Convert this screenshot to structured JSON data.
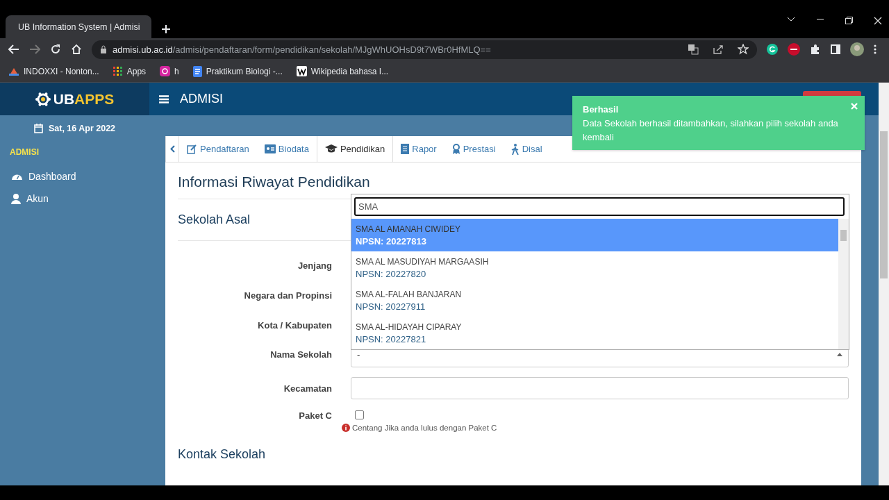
{
  "browser": {
    "tab_title": "UB Information System | Admisi",
    "url_host": "admisi.ub.ac.id",
    "url_path": "/admisi/pendaftaran/form/pendidikan/sekolah/MJgWhUOHsD9t7WBr0HfMLQ==",
    "bookmarks": [
      {
        "label": "INDOXXI - Nonton...",
        "kind": "film"
      },
      {
        "label": "Apps",
        "kind": "apps"
      },
      {
        "label": "h",
        "kind": "camera"
      },
      {
        "label": "Praktikum Biologi -...",
        "kind": "doc"
      },
      {
        "label": "Wikipedia bahasa I...",
        "kind": "wiki"
      }
    ]
  },
  "header": {
    "logo_prefix": "UB",
    "logo_suffix": "APPS",
    "title": "ADMISI"
  },
  "sidebar": {
    "date": "Sat, 16 Apr 2022",
    "section": "ADMISI",
    "items": [
      {
        "label": "Dashboard",
        "kind": "dashboard"
      },
      {
        "label": "Akun",
        "kind": "user"
      }
    ]
  },
  "tabs": [
    {
      "label": "Pendaftaran",
      "kind": "edit",
      "selected": false
    },
    {
      "label": "Biodata",
      "kind": "card",
      "selected": false
    },
    {
      "label": "Pendidikan",
      "kind": "cap",
      "selected": true
    },
    {
      "label": "Rapor",
      "kind": "list",
      "selected": false
    },
    {
      "label": "Prestasi",
      "kind": "award",
      "selected": false
    },
    {
      "label": "Disal",
      "kind": "person",
      "selected": false
    }
  ],
  "form": {
    "title": "Informasi Riwayat Pendidikan",
    "section": "Sekolah Asal",
    "fields": [
      {
        "label": "Jenjang",
        "kind": "hidden"
      },
      {
        "label": "Negara dan Propinsi",
        "kind": "hidden"
      },
      {
        "label": "Kota / Kabupaten",
        "kind": "hidden"
      },
      {
        "label": "Nama Sekolah",
        "kind": "select",
        "value": "-"
      },
      {
        "label": "Kecamatan",
        "kind": "text"
      },
      {
        "label": "Paket C",
        "kind": "checkbox",
        "checked": false,
        "hint": "Centang Jika anda lulus dengan Paket C"
      }
    ],
    "next_section": "Kontak Sekolah"
  },
  "dropdown": {
    "search": "SMA",
    "options": [
      {
        "name": "SMA AL AMANAH CIWIDEY",
        "npsn": "NPSN: 20227813",
        "selected": true
      },
      {
        "name": "SMA AL MASUDIYAH MARGAASIH",
        "npsn": "NPSN: 20227820",
        "selected": false
      },
      {
        "name": "SMA AL-FALAH BANJARAN",
        "npsn": "NPSN: 20227911",
        "selected": false
      },
      {
        "name": "SMA AL-HIDAYAH CIPARAY",
        "npsn": "NPSN: 20227821",
        "selected": false
      }
    ]
  },
  "toast": {
    "title": "Berhasil",
    "message": "Data Sekolah berhasil ditambahkan, silahkan pilih sekolah anda kembali"
  }
}
